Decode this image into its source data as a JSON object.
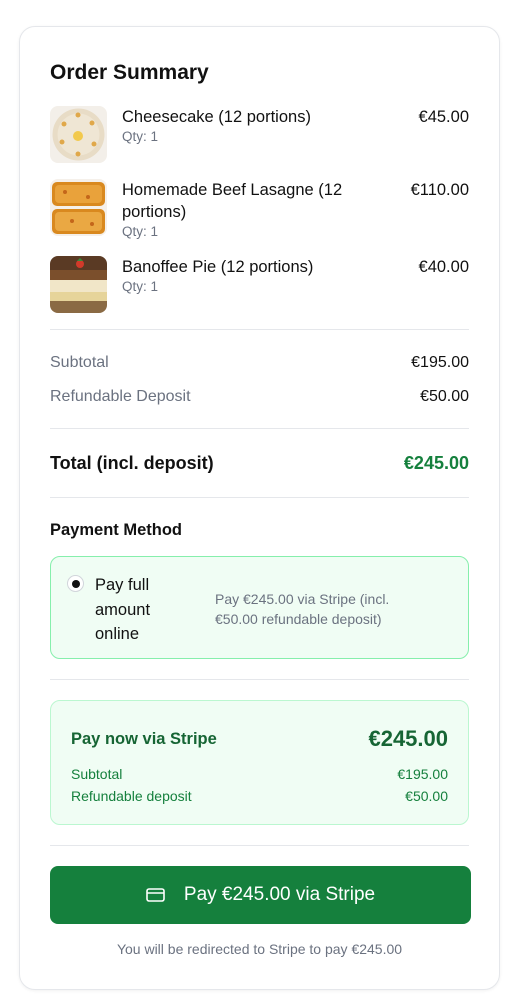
{
  "order": {
    "title": "Order Summary",
    "items": [
      {
        "name": "Cheesecake (12 portions)",
        "qty": "Qty: 1",
        "price": "€45.00",
        "image_icon": "cheesecake-image"
      },
      {
        "name": "Homemade Beef Lasagne (12 portions)",
        "qty": "Qty: 1",
        "price": "€110.00",
        "image_icon": "lasagne-image"
      },
      {
        "name": "Banoffee Pie (12 portions)",
        "qty": "Qty: 1",
        "price": "€40.00",
        "image_icon": "banoffee-pie-image"
      }
    ],
    "subtotal_label": "Subtotal",
    "subtotal_value": "€195.00",
    "deposit_label": "Refundable Deposit",
    "deposit_value": "€50.00",
    "total_label": "Total (incl. deposit)",
    "total_value": "€245.00"
  },
  "payment": {
    "title": "Payment Method",
    "option_label": "Pay full amount online",
    "option_desc": "Pay €245.00 via Stripe (incl. €50.00 refundable deposit)",
    "option_selected": true
  },
  "stripe_summary": {
    "label": "Pay now via Stripe",
    "amount": "€245.00",
    "subtotal_label": "Subtotal",
    "subtotal_value": "€195.00",
    "deposit_label": "Refundable deposit",
    "deposit_value": "€50.00"
  },
  "checkout": {
    "button_label": "Pay €245.00 via Stripe",
    "button_icon": "credit-card-icon",
    "note": "You will be redirected to Stripe to pay €245.00"
  },
  "colors": {
    "accent": "#15803d",
    "accent_dark": "#166534",
    "panel_bg": "#f0fdf4",
    "panel_border": "#86efac"
  }
}
